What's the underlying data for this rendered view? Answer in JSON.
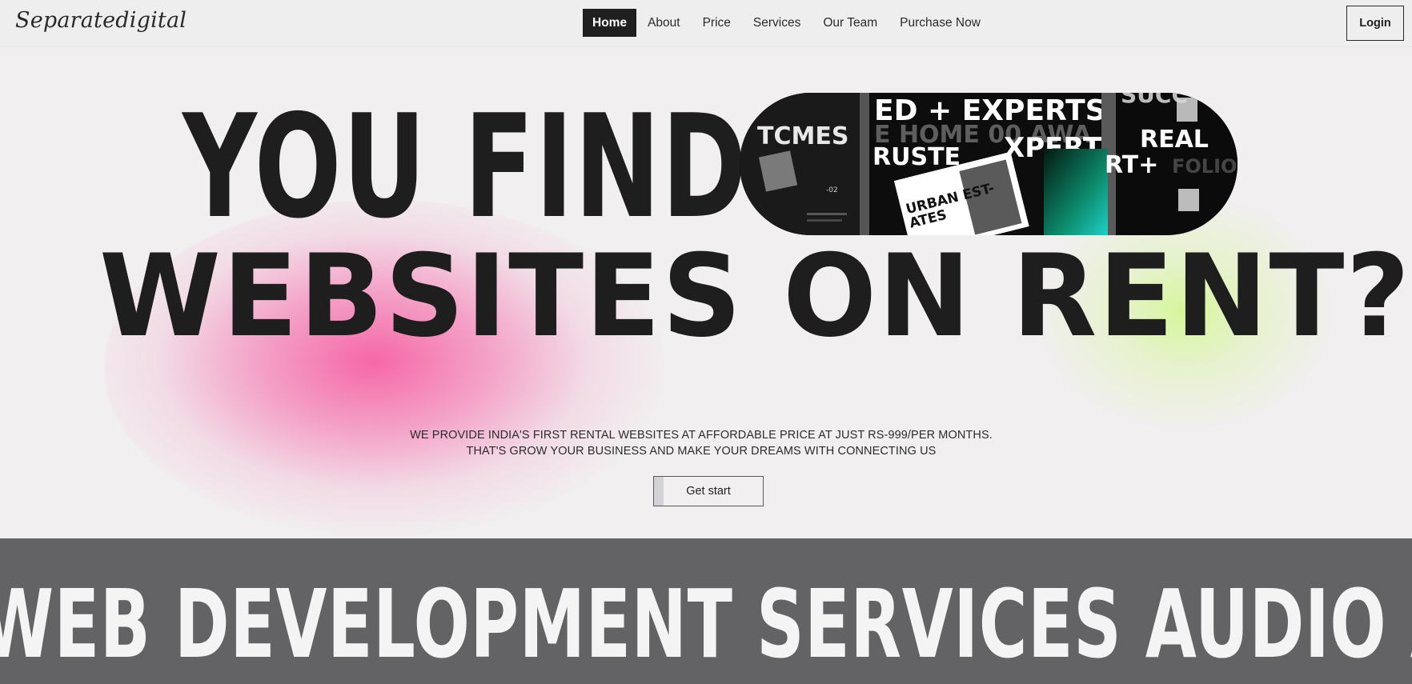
{
  "nav": {
    "logo": "Separatedigital",
    "menu": [
      {
        "label": "Home",
        "active": true
      },
      {
        "label": "About",
        "active": false
      },
      {
        "label": "Price",
        "active": false
      },
      {
        "label": "Services",
        "active": false
      },
      {
        "label": "Our Team",
        "active": false
      },
      {
        "label": "Purchase Now",
        "active": false
      }
    ],
    "login_label": "Login"
  },
  "hero": {
    "line1": "YOU FIND",
    "line2": "WEBSITES ON RENT?",
    "subtext1": "WE PROVIDE INDIA'S FIRST RENTAL WEBSITES AT AFFORDABLE PRICE AT JUST RS-999/PER MONTHS.",
    "subtext2": "THAT'S GROW YOUR BUSINESS AND MAKE YOUR DREAMS WITH CONNECTING US",
    "cta_label": "Get start",
    "pill_image_texts": {
      "t1": "TCMES",
      "t2": "ED + EXPERTS IN",
      "t3": "E HOME 00 AWA",
      "t4": "RUSTE",
      "t5": "XPERT",
      "t6": "REAL",
      "t7": "RT+",
      "t8": "URBAN EST-",
      "t9": "ATES",
      "t10": "-02",
      "t11": "SUCC",
      "t12": "FOLIO"
    }
  },
  "marquee": {
    "text": "WEB DEVELOPMENT SERVICES AUDIO ADV"
  },
  "colors": {
    "accent_dark": "#1f1f1f",
    "band": "#636365",
    "pink_blob": "#f660a3",
    "green_blob": "#d4f796",
    "neon_green": "#2ee84a"
  }
}
